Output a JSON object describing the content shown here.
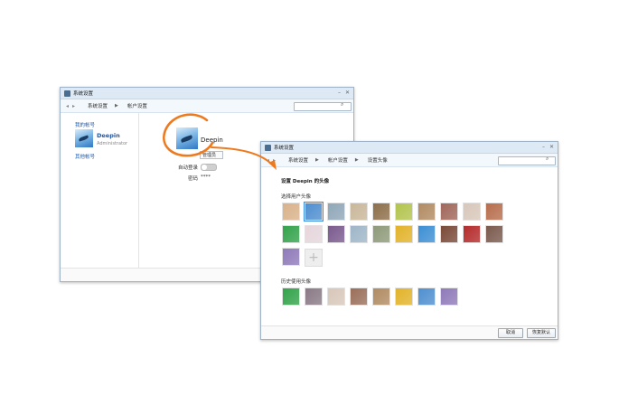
{
  "windows": {
    "back": {
      "title": "系统设置",
      "breadcrumb": [
        "系统设置",
        "帐户设置"
      ],
      "sidebar": {
        "my_account": "我的帐号",
        "user_name": "Deepin",
        "user_role": "Administrator",
        "other_accounts": "其他帐号"
      },
      "main": {
        "user_name": "Deepin",
        "account_type_value": "管理员",
        "auto_login_label": "自动登录",
        "password_label": "密码",
        "password_value": "****"
      }
    },
    "front": {
      "title": "系统设置",
      "breadcrumb": [
        "系统设置",
        "帐户设置",
        "设置头像"
      ],
      "heading": "设置 Deepin 的头像",
      "section_choose": "选择用户头像",
      "section_history": "历史使用头像",
      "cancel_label": "取消",
      "restore_label": "恢复默认"
    }
  },
  "avatars": {
    "choose": [
      {
        "name": "fox-avatar",
        "color": "#d9b28a"
      },
      {
        "name": "bird-avatar",
        "color": "#4f8fd0"
      },
      {
        "name": "ship-avatar",
        "color": "#8fa7b8"
      },
      {
        "name": "couple-avatar",
        "color": "#c9b79a"
      },
      {
        "name": "bridge-avatar",
        "color": "#8d6f4a"
      },
      {
        "name": "flowers-avatar",
        "color": "#b3c44d"
      },
      {
        "name": "horse-avatar",
        "color": "#b18b63"
      },
      {
        "name": "desk-avatar",
        "color": "#a0675a"
      },
      {
        "name": "cat-avatar",
        "color": "#d8c7ba"
      },
      {
        "name": "dog-avatar",
        "color": "#b76e4d"
      },
      {
        "name": "thermal-avatar",
        "color": "#33a34b"
      },
      {
        "name": "flower-avatar",
        "color": "#e5d6dc"
      },
      {
        "name": "dancer-avatar",
        "color": "#7a5a8e"
      },
      {
        "name": "swirl-avatar",
        "color": "#9fb6c8"
      },
      {
        "name": "lake-avatar",
        "color": "#8e9a7a"
      },
      {
        "name": "pooh-avatar",
        "color": "#e2b32a"
      },
      {
        "name": "doraemon-avatar",
        "color": "#3d8fd4"
      },
      {
        "name": "mecha-avatar",
        "color": "#7a4a38"
      },
      {
        "name": "rose-avatar",
        "color": "#b52b2b"
      },
      {
        "name": "girl-avatar",
        "color": "#7b5a4e"
      },
      {
        "name": "purple-avatar",
        "color": "#8f7ab9"
      }
    ],
    "history": [
      {
        "name": "thermal-avatar",
        "color": "#33a34b"
      },
      {
        "name": "dog-avatar",
        "color": "#8a7a86"
      },
      {
        "name": "cat-avatar",
        "color": "#d8c7ba"
      },
      {
        "name": "girl-avatar",
        "color": "#9a6f5a"
      },
      {
        "name": "horse-avatar",
        "color": "#b18b63"
      },
      {
        "name": "pooh-avatar",
        "color": "#e2b32a"
      },
      {
        "name": "bird-avatar",
        "color": "#4f8fd0"
      },
      {
        "name": "purple-avatar",
        "color": "#8f7ab9"
      }
    ]
  },
  "colors": {
    "accent": "#1f59a8",
    "highlight_ring": "#ee7a1f",
    "titlebar": "#dde9f5"
  }
}
